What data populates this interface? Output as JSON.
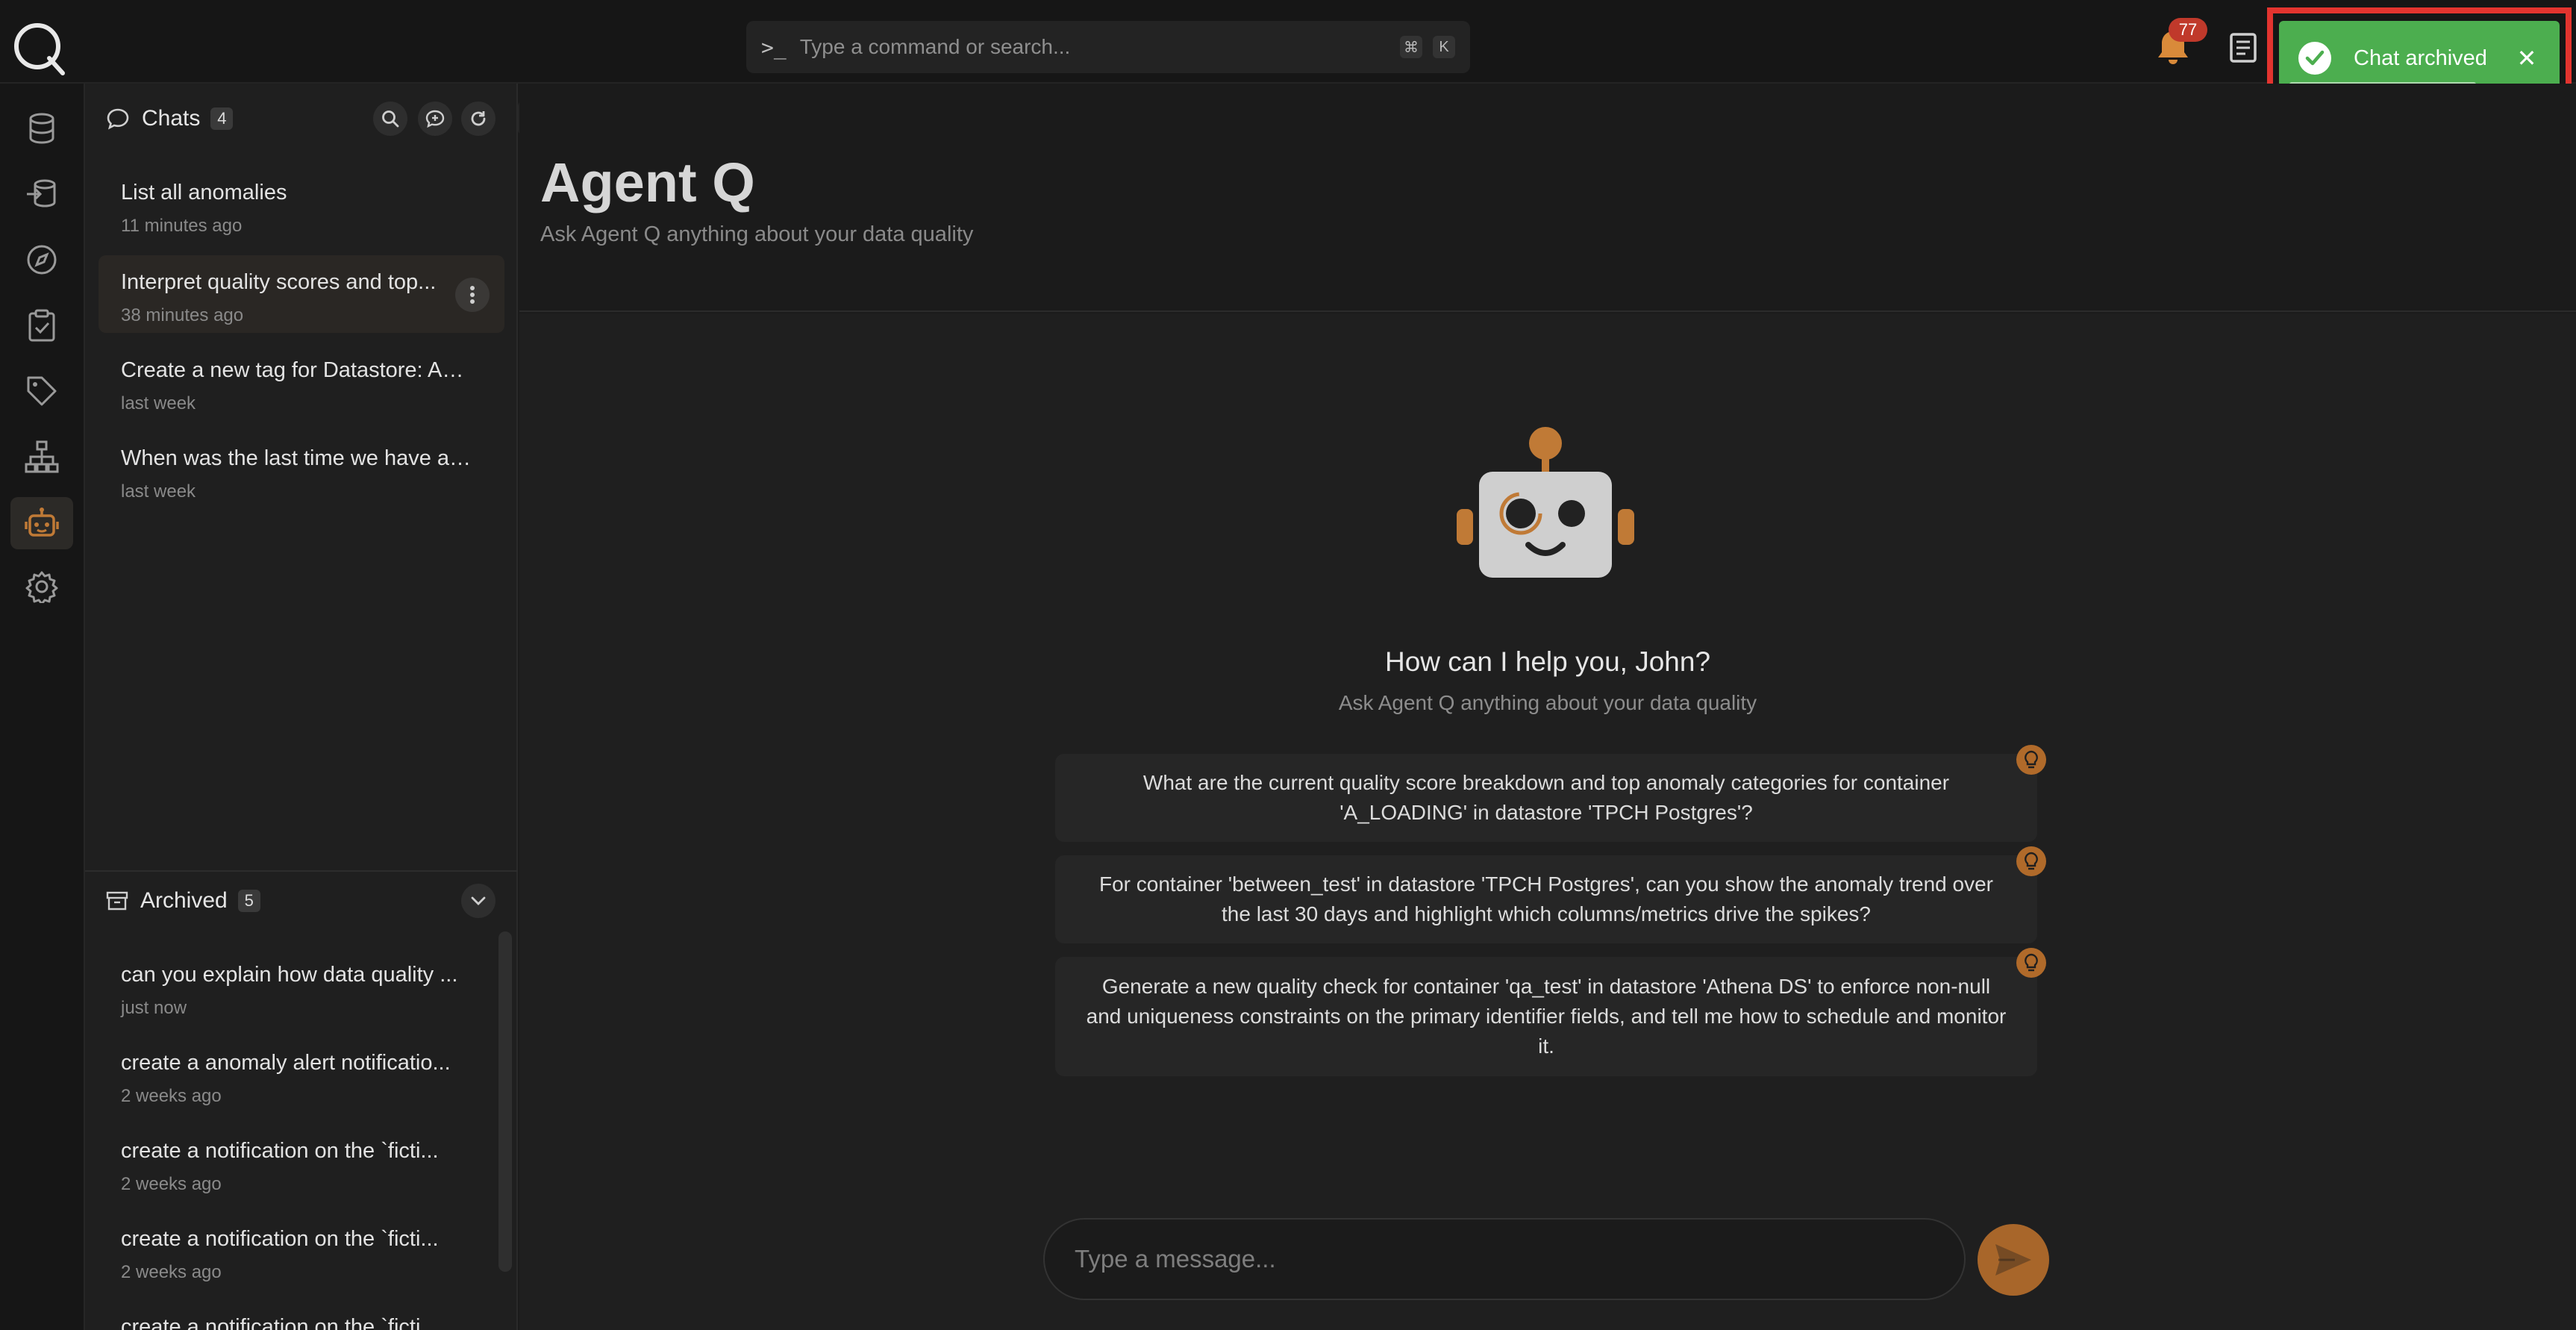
{
  "topbar": {
    "search_placeholder": "Type a command or search...",
    "search_prompt": ">_",
    "shortcut_keys": [
      "⌘",
      "K"
    ],
    "notification_count": "77"
  },
  "toast": {
    "message": "Chat archived",
    "close": "✕",
    "color": "#4cae4f"
  },
  "nav": {
    "icons": [
      "database-icon",
      "source-import-icon",
      "compass-icon",
      "clipboard-check-icon",
      "tag-icon",
      "hierarchy-icon",
      "robot-icon",
      "gear-icon"
    ],
    "active": "robot-icon",
    "accent": "#c07a36"
  },
  "chats": {
    "title": "Chats",
    "count": "4",
    "items": [
      {
        "title": "List all anomalies",
        "time": "11 minutes ago"
      },
      {
        "title": "Interpret quality scores and top...",
        "time": "38 minutes ago"
      },
      {
        "title": "Create a new tag for Datastore: An...",
        "time": "last week"
      },
      {
        "title": "When was the last time we have an ...",
        "time": "last week"
      }
    ]
  },
  "archived": {
    "title": "Archived",
    "count": "5",
    "items": [
      {
        "title": "can you explain how data quality ...",
        "time": "just now"
      },
      {
        "title": "create a anomaly alert notificatio...",
        "time": "2 weeks ago"
      },
      {
        "title": "create a notification on the `ficti...",
        "time": "2 weeks ago"
      },
      {
        "title": "create a notification on the `ficti...",
        "time": "2 weeks ago"
      },
      {
        "title": "create a notification on the `ficti...",
        "time": ""
      }
    ]
  },
  "header": {
    "title": "Agent Q",
    "subtitle": "Ask Agent Q anything about your data quality"
  },
  "welcome": {
    "greeting": "How can I help you, John?",
    "subtitle": "Ask Agent Q anything about your data quality"
  },
  "suggestions": [
    "What are the current quality score breakdown and top anomaly categories for container 'A_LOADING' in datastore 'TPCH Postgres'?",
    "For container 'between_test' in datastore 'TPCH Postgres', can you show the anomaly trend over the last 30 days and highlight which columns/metrics drive the spikes?",
    "Generate a new quality check for container 'qa_test' in datastore 'Athena DS' to enforce non-null and uniqueness constraints on the primary identifier fields, and tell me how to schedule and monitor it."
  ],
  "composer": {
    "placeholder": "Type a message..."
  }
}
